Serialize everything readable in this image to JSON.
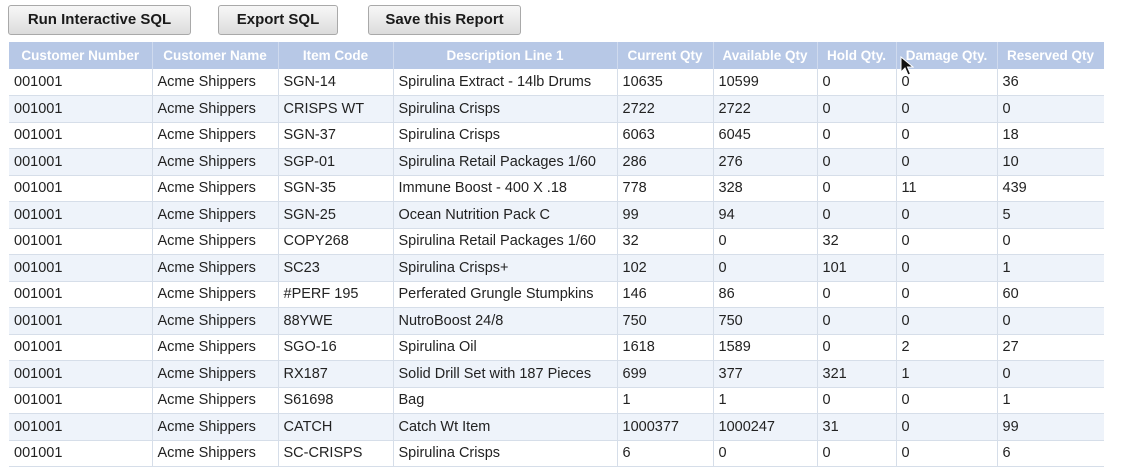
{
  "toolbar": {
    "run_label": "Run Interactive SQL",
    "export_label": "Export SQL",
    "save_label": "Save this Report"
  },
  "report": {
    "columns": [
      "Customer Number",
      "Customer Name",
      "Item Code",
      "Description Line 1",
      "Current Qty",
      "Available Qty",
      "Hold Qty.",
      "Damage Qty.",
      "Reserved Qty"
    ],
    "rows": [
      [
        "001001",
        "Acme Shippers",
        "SGN-14",
        "Spirulina Extract - 14lb Drums",
        "10635",
        "10599",
        "0",
        "0",
        "36"
      ],
      [
        "001001",
        "Acme Shippers",
        "CRISPS WT",
        "Spirulina Crisps",
        "2722",
        "2722",
        "0",
        "0",
        "0"
      ],
      [
        "001001",
        "Acme Shippers",
        "SGN-37",
        "Spirulina Crisps",
        "6063",
        "6045",
        "0",
        "0",
        "18"
      ],
      [
        "001001",
        "Acme Shippers",
        "SGP-01",
        "Spirulina Retail Packages 1/60",
        "286",
        "276",
        "0",
        "0",
        "10"
      ],
      [
        "001001",
        "Acme Shippers",
        "SGN-35",
        "Immune Boost - 400 X .18",
        "778",
        "328",
        "0",
        "11",
        "439"
      ],
      [
        "001001",
        "Acme Shippers",
        "SGN-25",
        "Ocean Nutrition Pack C",
        "99",
        "94",
        "0",
        "0",
        "5"
      ],
      [
        "001001",
        "Acme Shippers",
        "COPY268",
        "Spirulina Retail Packages 1/60",
        "32",
        "0",
        "32",
        "0",
        "0"
      ],
      [
        "001001",
        "Acme Shippers",
        "SC23",
        "Spirulina Crisps+",
        "102",
        "0",
        "101",
        "0",
        "1"
      ],
      [
        "001001",
        "Acme Shippers",
        "#PERF 195",
        "Perferated Grungle Stumpkins",
        "146",
        "86",
        "0",
        "0",
        "60"
      ],
      [
        "001001",
        "Acme Shippers",
        "88YWE",
        "NutroBoost 24/8",
        "750",
        "750",
        "0",
        "0",
        "0"
      ],
      [
        "001001",
        "Acme Shippers",
        "SGO-16",
        "Spirulina Oil",
        "1618",
        "1589",
        "0",
        "2",
        "27"
      ],
      [
        "001001",
        "Acme Shippers",
        "RX187",
        "Solid Drill Set with 187 Pieces",
        "699",
        "377",
        "321",
        "1",
        "0"
      ],
      [
        "001001",
        "Acme Shippers",
        "S61698",
        "Bag",
        "1",
        "1",
        "0",
        "0",
        "1"
      ],
      [
        "001001",
        "Acme Shippers",
        "CATCH",
        "Catch Wt Item",
        "1000377",
        "1000247",
        "31",
        "0",
        "99"
      ],
      [
        "001001",
        "Acme Shippers",
        "SC-CRISPS",
        "Spirulina Crisps",
        "6",
        "0",
        "0",
        "0",
        "6"
      ]
    ]
  },
  "icons": {
    "cursor": "mouse-pointer-icon"
  },
  "colors": {
    "header_bg": "#b7c8e6",
    "row_alt_bg": "#eef3fa"
  }
}
